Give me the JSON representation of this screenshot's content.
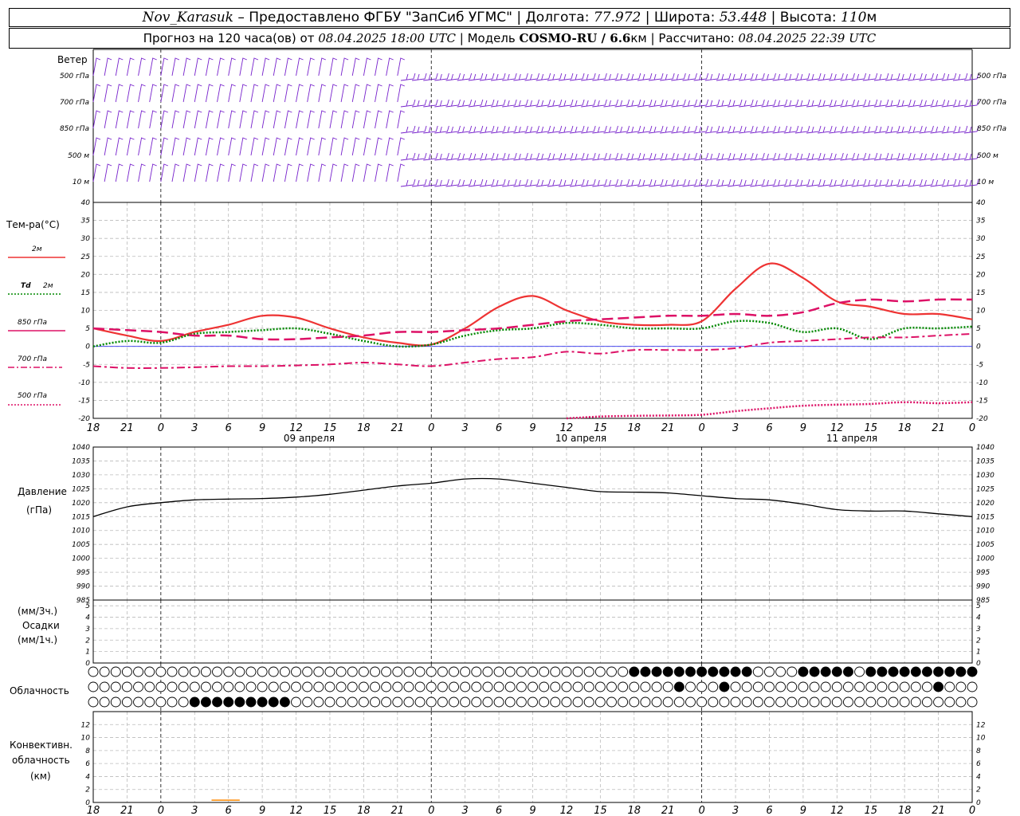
{
  "header": {
    "station": "Nov_Karasuk",
    "provider": " – Предоставлено ФГБУ \"ЗапСиб УГМС\" | Долгота: ",
    "lon": "77.972",
    "lat_label": " | Широта: ",
    "lat": "53.448",
    "alt_label": " | Высота: ",
    "alt": "110",
    "alt_unit": "м"
  },
  "subheader": {
    "prefix": "Прогноз на 120 часа(ов) от ",
    "from": "08.04.2025 18:00 UTC",
    "model_label": " | Модель ",
    "model": "COSMO-RU / 6.6",
    "model_unit": "км",
    "calc_label": " | Рассчитано: ",
    "calc": "08.04.2025 22:39 UTC"
  },
  "labels": {
    "wind": "Ветер",
    "wind_levels": [
      "500 гПа",
      "700 гПа",
      "850 гПа",
      "500 м",
      "10 м"
    ],
    "temp": "Тем-ра(°С)",
    "t2m": "2м",
    "td_a": "Td",
    "td_b": "2м",
    "t850": "850 гПа",
    "t700": "700 гПа",
    "t500": "500 гПа",
    "pressure": "Давление",
    "pressure_unit": "(гПа)",
    "precip_unit_3h": "(мм/3ч.)",
    "precip": "Осадки",
    "precip_unit_1h": "(мм/1ч.)",
    "cloud": "Облачность",
    "conv1": "Конвективн.",
    "conv2": "облачность",
    "conv3": "(км)",
    "dates": [
      "09 апреля",
      "10 апреля",
      "11 апреля"
    ],
    "hour_ticks": [
      "18",
      "21",
      "0",
      "3",
      "6",
      "9",
      "12",
      "15",
      "18",
      "21",
      "0",
      "3",
      "6",
      "9",
      "12",
      "15",
      "18",
      "21",
      "0",
      "3",
      "6",
      "9",
      "12",
      "15",
      "18",
      "21",
      "0"
    ],
    "temp_ticks": [
      "40",
      "35",
      "30",
      "25",
      "20",
      "15",
      "10",
      "5",
      "0",
      "-5",
      "-10",
      "-15",
      "-20"
    ],
    "pres_ticks": [
      "1040",
      "1035",
      "1030",
      "1025",
      "1020",
      "1015",
      "1010",
      "1005",
      "1000",
      "995",
      "990",
      "985"
    ],
    "precip_ticks": [
      "5",
      "4",
      "3",
      "2",
      "1",
      "0"
    ],
    "conv_ticks": [
      "12",
      "10",
      "8",
      "6",
      "4",
      "2",
      "0"
    ]
  },
  "colors": {
    "t2m": "#ee3333",
    "td2m": "#008800",
    "t850": "#dd1166",
    "t700": "#dd1166",
    "t500": "#dd1166",
    "wind": "#7722cc",
    "pressure": "#000000",
    "conv": "#ff8800"
  },
  "chart_data": [
    {
      "type": "line",
      "title": "Тем-ра(°С)",
      "x_hours": [
        0,
        3,
        6,
        9,
        12,
        15,
        18,
        21,
        24,
        27,
        30,
        33,
        36,
        39,
        42,
        45,
        48,
        51,
        54,
        57,
        60,
        63,
        66,
        69,
        72,
        75,
        78
      ],
      "ylim": [
        -20,
        40
      ],
      "series": [
        {
          "name": "2м",
          "values": [
            5,
            3,
            1.5,
            4,
            6,
            8.5,
            8,
            5,
            2.5,
            1,
            0.5,
            5,
            11,
            14,
            10,
            7,
            6,
            6,
            7,
            16,
            23,
            19,
            12.5,
            11,
            9,
            9,
            7.5
          ]
        },
        {
          "name": "Td 2м",
          "values": [
            0,
            1.5,
            1,
            3.5,
            4,
            4.5,
            5,
            3.5,
            1.5,
            0,
            0.5,
            3,
            4.5,
            5,
            6.5,
            6,
            5,
            5,
            5,
            7,
            6.5,
            4,
            5,
            2,
            5,
            5,
            5.5
          ]
        },
        {
          "name": "850 гПа",
          "values": [
            5,
            4.5,
            4,
            3,
            3,
            2,
            2,
            2.5,
            3,
            4,
            4,
            4.5,
            5,
            6,
            7,
            7.5,
            8,
            8.5,
            8.5,
            9,
            8.5,
            9.5,
            12,
            13,
            12.5,
            13,
            13
          ]
        },
        {
          "name": "700 гПа",
          "values": [
            -5.5,
            -6,
            -6,
            -5.8,
            -5.5,
            -5.5,
            -5.3,
            -5,
            -4.5,
            -5,
            -5.5,
            -4.5,
            -3.5,
            -3,
            -1.5,
            -2,
            -1,
            -1,
            -1,
            -0.5,
            1,
            1.5,
            2,
            2.5,
            2.5,
            3,
            3.5
          ]
        },
        {
          "name": "500 гПа",
          "values": [
            null,
            null,
            null,
            null,
            null,
            null,
            null,
            null,
            null,
            null,
            null,
            null,
            null,
            null,
            -20,
            -19.5,
            -19.3,
            -19.2,
            -19,
            -18,
            -17.2,
            -16.5,
            -16.2,
            -16,
            -15.5,
            -15.8,
            -15.5
          ]
        }
      ]
    },
    {
      "type": "line",
      "title": "Давление",
      "x_hours": [
        0,
        3,
        6,
        9,
        12,
        15,
        18,
        21,
        24,
        27,
        30,
        33,
        36,
        39,
        42,
        45,
        48,
        51,
        54,
        57,
        60,
        63,
        66,
        69,
        72,
        75,
        78
      ],
      "ylim": [
        985,
        1040
      ],
      "series": [
        {
          "name": "Давление",
          "values": [
            1015,
            1018.5,
            1020,
            1021,
            1021.3,
            1021.5,
            1022,
            1023,
            1024.5,
            1026,
            1027,
            1028.5,
            1028.5,
            1027,
            1025.5,
            1024,
            1023.8,
            1023.5,
            1022.5,
            1021.5,
            1021,
            1019.5,
            1017.5,
            1017,
            1017,
            1016,
            1015
          ]
        }
      ]
    }
  ]
}
